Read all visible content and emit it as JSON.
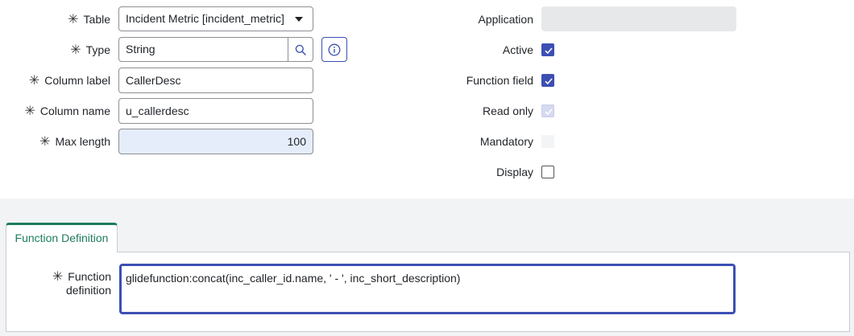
{
  "form": {
    "table": {
      "label": "Table",
      "value": "Incident Metric [incident_metric]"
    },
    "type": {
      "label": "Type",
      "value": "String"
    },
    "column_label": {
      "label": "Column label",
      "value": "CallerDesc"
    },
    "column_name": {
      "label": "Column name",
      "value": "u_callerdesc"
    },
    "max_length": {
      "label": "Max length",
      "value": "100"
    }
  },
  "right": {
    "application": {
      "label": "Application",
      "value": ""
    },
    "active": {
      "label": "Active",
      "checked": true
    },
    "function_field": {
      "label": "Function field",
      "checked": true
    },
    "read_only": {
      "label": "Read only",
      "checked": true,
      "disabled": true
    },
    "mandatory": {
      "label": "Mandatory",
      "checked": false
    },
    "display": {
      "label": "Display",
      "checked": false
    }
  },
  "tab": {
    "label": "Function Definition"
  },
  "function_definition": {
    "label_line1": "Function",
    "label_line2": "definition",
    "value": "glidefunction:concat(inc_caller_id.name, ' - ', inc_short_description)"
  },
  "colors": {
    "accent": "#3c4fb3",
    "tab_accent": "#1e7d5a",
    "highlight_bg": "#e5edfa"
  },
  "icons": {
    "required": "asterisk-icon",
    "search": "search-icon",
    "info": "info-icon",
    "dropdown": "caret-down-icon",
    "check": "check-icon"
  }
}
